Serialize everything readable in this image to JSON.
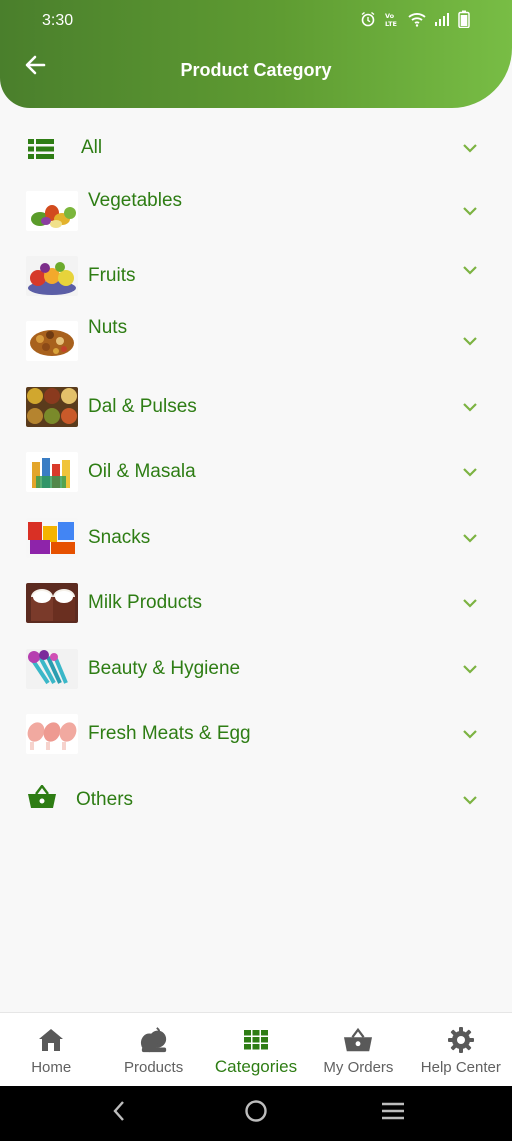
{
  "status_bar": {
    "time": "3:30",
    "icons": [
      "alarm-icon",
      "volte-icon",
      "wifi-icon",
      "signal-icon",
      "battery-icon"
    ]
  },
  "app_bar": {
    "title": "Product Category",
    "back_icon": "arrow-left-icon"
  },
  "categories": [
    {
      "label": "All",
      "icon": "list-icon"
    },
    {
      "label": "Vegetables",
      "icon": "vegetables-image"
    },
    {
      "label": "Fruits",
      "icon": "fruits-image"
    },
    {
      "label": "Nuts",
      "icon": "nuts-image"
    },
    {
      "label": "Dal & Pulses",
      "icon": "dal-pulses-image"
    },
    {
      "label": "Oil & Masala",
      "icon": "oil-masala-image"
    },
    {
      "label": "Snacks",
      "icon": "snacks-image"
    },
    {
      "label": "Milk Products",
      "icon": "milk-products-image"
    },
    {
      "label": "Beauty & Hygiene",
      "icon": "beauty-hygiene-image"
    },
    {
      "label": "Fresh Meats & Egg",
      "icon": "fresh-meats-image"
    },
    {
      "label": "Others",
      "icon": "basket-icon"
    }
  ],
  "bottom_nav": [
    {
      "label": "Home",
      "icon": "home-icon",
      "active": false
    },
    {
      "label": "Products",
      "icon": "fruit-basket-icon",
      "active": false
    },
    {
      "label": "Categories",
      "icon": "grid-icon",
      "active": true
    },
    {
      "label": "My Orders",
      "icon": "basket-icon",
      "active": false
    },
    {
      "label": "Help Center",
      "icon": "gear-icon",
      "active": false
    }
  ],
  "colors": {
    "primary_green": "#2e7d14",
    "header_gradient_start": "#4a7f2c",
    "header_gradient_end": "#78bd45",
    "chevron": "#7cb342"
  }
}
